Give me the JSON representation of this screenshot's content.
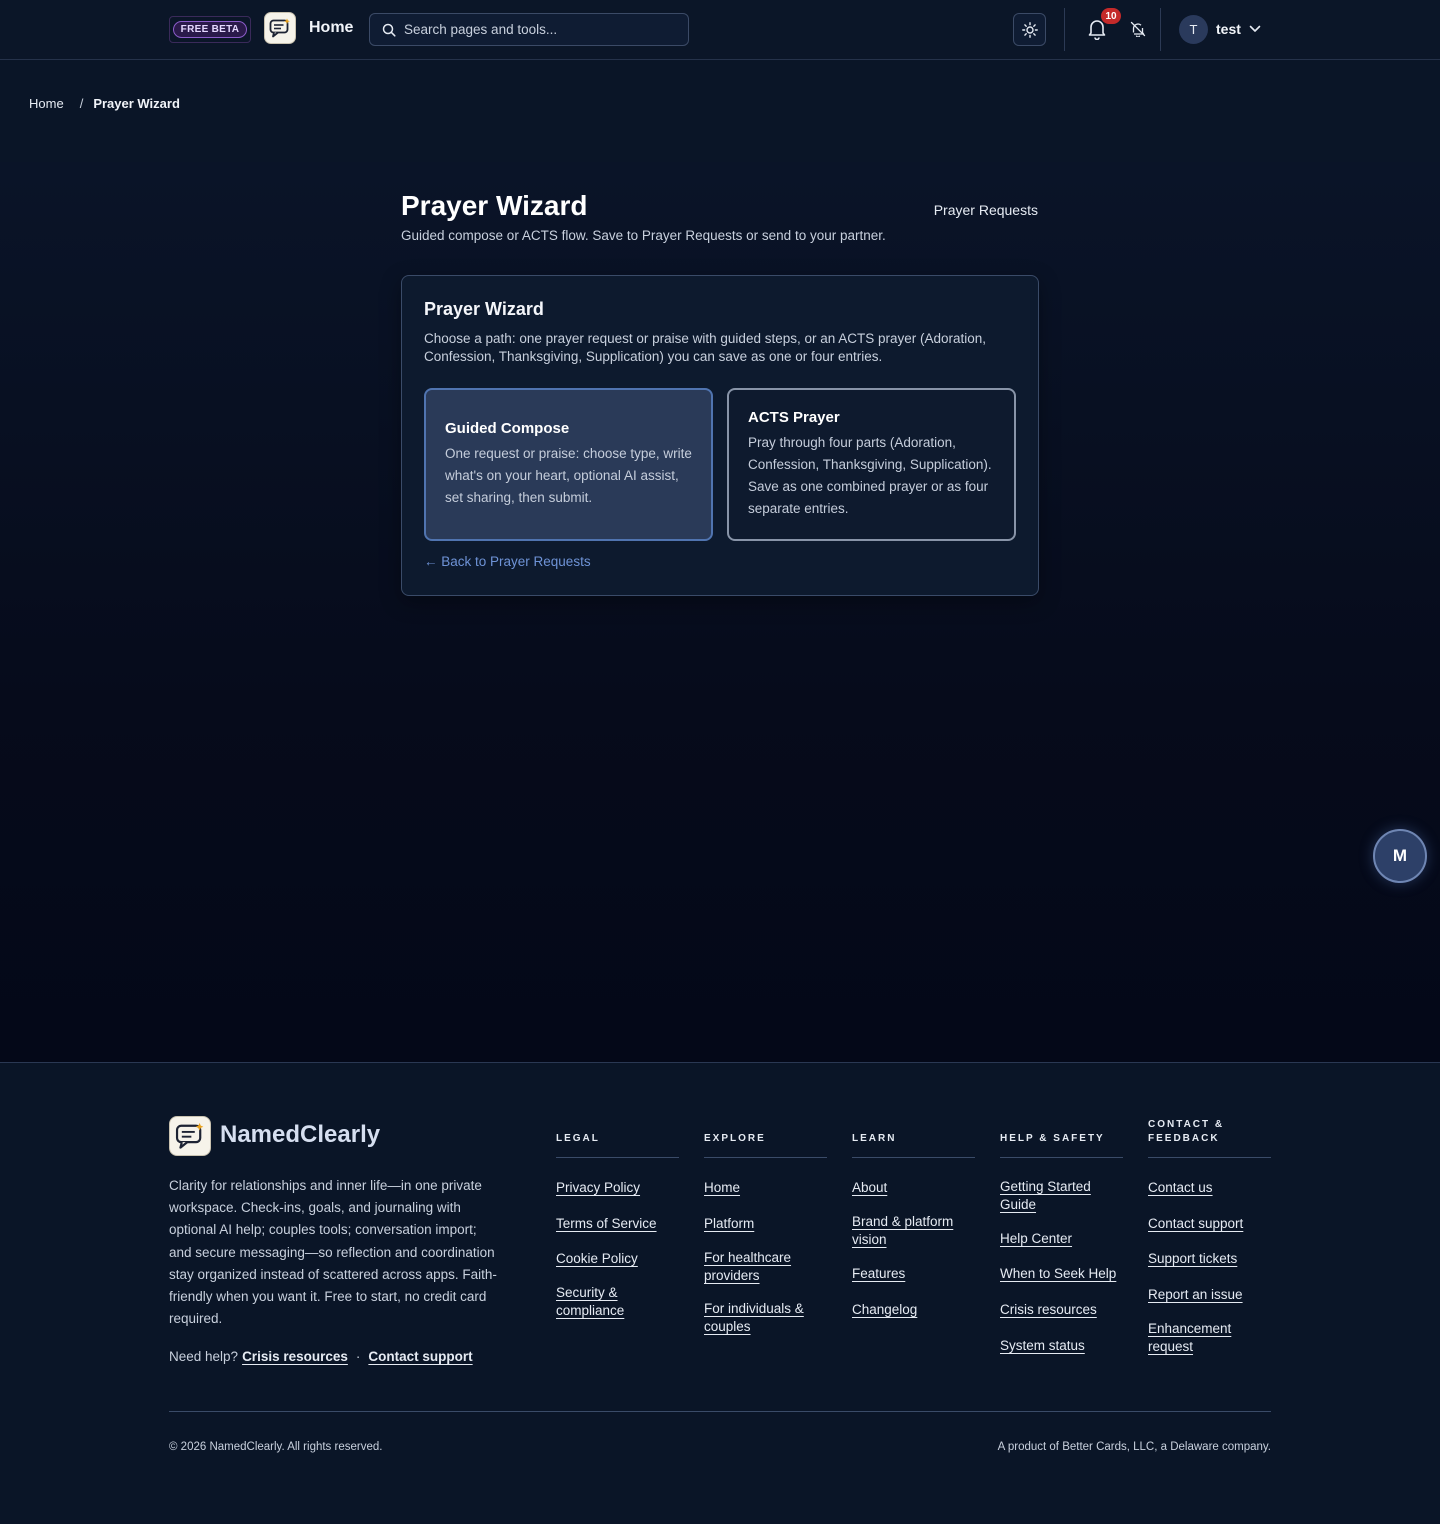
{
  "header": {
    "beta_label": "FREE BETA",
    "home_label": "Home",
    "search_placeholder": "Search pages and tools...",
    "notification_count": "10",
    "user_initial": "T",
    "user_name": "test"
  },
  "breadcrumb": {
    "home": "Home",
    "separator": "/",
    "current": "Prayer Wizard"
  },
  "page": {
    "title": "Prayer Wizard",
    "subtitle": "Guided compose or ACTS flow. Save to Prayer Requests or send to your partner.",
    "requests_link": "Prayer Requests"
  },
  "wizard": {
    "title": "Prayer Wizard",
    "description": "Choose a path: one prayer request or praise with guided steps, or an ACTS prayer (Adoration, Confession, Thanksgiving, Supplication) you can save as one or four entries.",
    "options": [
      {
        "title": "Guided Compose",
        "description": "One request or praise: choose type, write what's on your heart, optional AI assist, set sharing, then submit."
      },
      {
        "title": "ACTS Prayer",
        "description": "Pray through four parts (Adoration, Confession, Thanksgiving, Supplication). Save as one combined prayer or as four separate entries."
      }
    ],
    "back_link": "← Back to Prayer Requests"
  },
  "fab_label": "M",
  "footer": {
    "brand": "NamedClearly",
    "blurb": "Clarity for relationships and inner life—in one private workspace. Check-ins, goals, and journaling with optional AI help; couples tools; conversation import; and secure messaging—so reflection and coordination stay organized instead of scattered across apps. Faith-friendly when you want it. Free to start, no credit card required.",
    "help_prefix": "Need help?",
    "help_crisis": "Crisis resources",
    "help_dot": "·",
    "help_contact": "Contact support",
    "columns": [
      {
        "heading": "LEGAL",
        "links": [
          "Privacy Policy",
          "Terms of Service",
          "Cookie Policy",
          "Security & compliance"
        ]
      },
      {
        "heading": "EXPLORE",
        "links": [
          "Home",
          "Platform",
          "For healthcare providers",
          "For individuals & couples"
        ]
      },
      {
        "heading": "LEARN",
        "links": [
          "About",
          "Brand & platform vision",
          "Features",
          "Changelog"
        ]
      },
      {
        "heading": "HELP & SAFETY",
        "links": [
          "Getting Started Guide",
          "Help Center",
          "When to Seek Help",
          "Crisis resources",
          "System status"
        ]
      },
      {
        "heading": "CONTACT & FEEDBACK",
        "links": [
          "Contact us",
          "Contact support",
          "Support tickets",
          "Report an issue",
          "Enhancement request"
        ]
      }
    ],
    "copyright": "© 2026 NamedClearly. All rights reserved.",
    "product_note": "A product of Better Cards, LLC, a Delaware company."
  },
  "icons": {
    "search": "search-icon",
    "theme": "sun-icon",
    "notifications": "bell-icon",
    "mute": "bell-off-icon",
    "user_menu": "chevron-down-icon",
    "logo": "chat-bubble-logo-icon"
  },
  "colors": {
    "background": "#050a18",
    "header": "#0b1628",
    "accent_link": "#6e93d6",
    "badge": "#c42a2a",
    "beta_pill": "#8a5cc8"
  }
}
